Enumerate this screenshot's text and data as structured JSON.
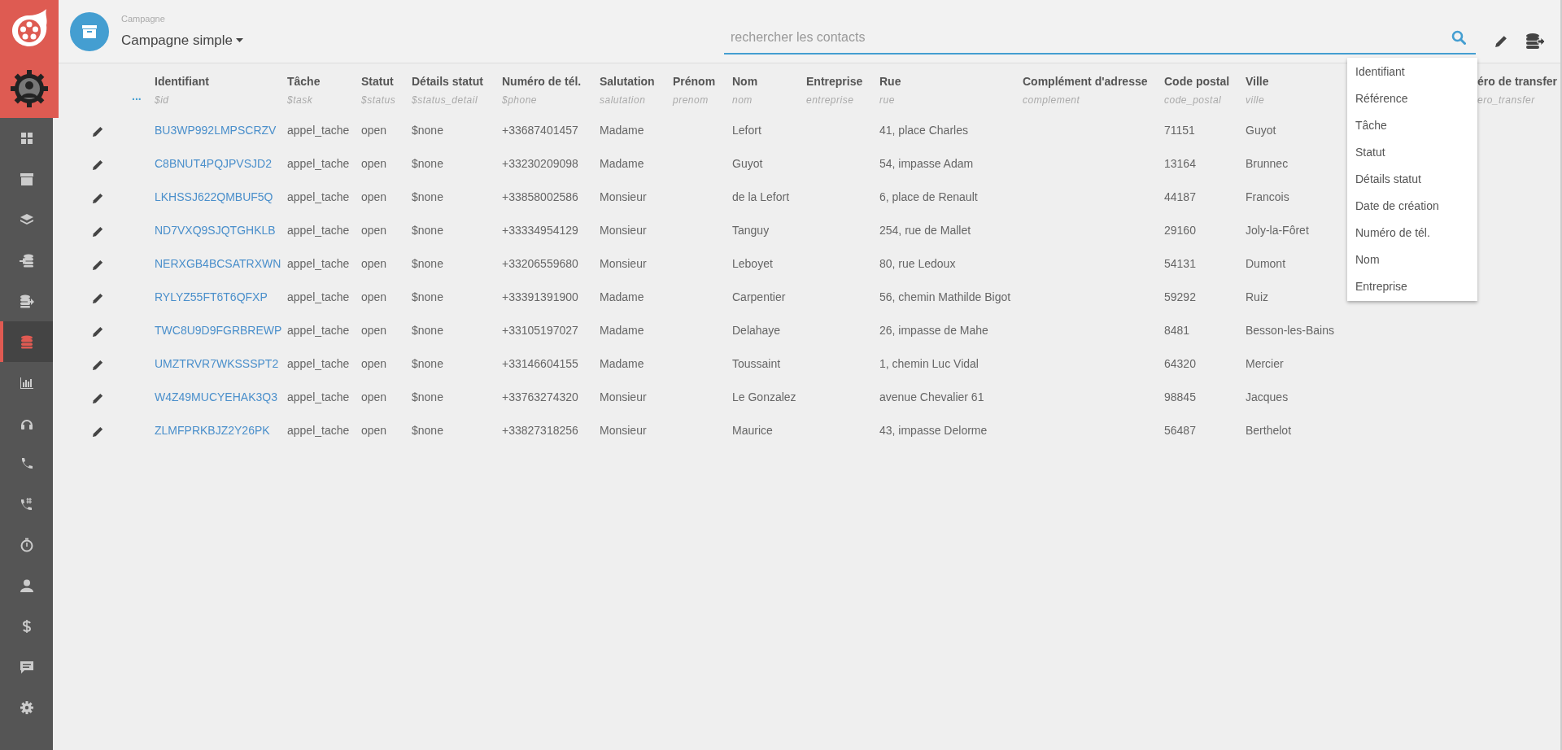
{
  "sidebar": {
    "items": [
      {
        "kind": "grid",
        "selected": false
      },
      {
        "kind": "archive",
        "selected": false
      },
      {
        "kind": "layers",
        "selected": false
      },
      {
        "kind": "db-import",
        "selected": false
      },
      {
        "kind": "db-export",
        "selected": false
      },
      {
        "kind": "database",
        "selected": true
      },
      {
        "kind": "chart",
        "selected": false
      },
      {
        "kind": "headset",
        "selected": false
      },
      {
        "kind": "phone",
        "selected": false
      },
      {
        "kind": "phone-hash",
        "selected": false
      },
      {
        "kind": "stopwatch",
        "selected": false
      },
      {
        "kind": "user",
        "selected": false
      },
      {
        "kind": "dollar",
        "selected": false
      },
      {
        "kind": "chat",
        "selected": false
      },
      {
        "kind": "gear",
        "selected": false
      }
    ]
  },
  "header": {
    "campaign_label": "Campagne",
    "campaign_name": "Campagne simple",
    "search": {
      "placeholder": "rechercher les contacts"
    }
  },
  "table": {
    "more_button": "...",
    "columns": [
      {
        "label": "Identifiant",
        "sub": "$id"
      },
      {
        "label": "Tâche",
        "sub": "$task"
      },
      {
        "label": "Statut",
        "sub": "$status"
      },
      {
        "label": "Détails statut",
        "sub": "$status_detail"
      },
      {
        "label": "Numéro de tél.",
        "sub": "$phone"
      },
      {
        "label": "Salutation",
        "sub": "salutation"
      },
      {
        "label": "Prénom",
        "sub": "prenom"
      },
      {
        "label": "Nom",
        "sub": "nom"
      },
      {
        "label": "Entreprise",
        "sub": "entreprise"
      },
      {
        "label": "Rue",
        "sub": "rue"
      },
      {
        "label": "Complément d'adresse",
        "sub": "complement"
      },
      {
        "label": "Code postal",
        "sub": "code_postal"
      },
      {
        "label": "Ville",
        "sub": "ville"
      },
      {
        "label": "éro de transfer",
        "sub": "ero_transfer"
      }
    ],
    "rows": [
      {
        "id": "BU3WP992LMPSCRZV",
        "task": "appel_tache",
        "status": "open",
        "status_detail": "$none",
        "phone": "+33687401457",
        "salutation": "Madame",
        "nom": "Lefort",
        "rue": "41, place Charles",
        "code_postal": "71151",
        "ville": "Guyot"
      },
      {
        "id": "C8BNUT4PQJPVSJD2",
        "task": "appel_tache",
        "status": "open",
        "status_detail": "$none",
        "phone": "+33230209098",
        "salutation": "Madame",
        "nom": "Guyot",
        "rue": "54, impasse Adam",
        "code_postal": "13164",
        "ville": "Brunnec"
      },
      {
        "id": "LKHSSJ622QMBUF5Q",
        "task": "appel_tache",
        "status": "open",
        "status_detail": "$none",
        "phone": "+33858002586",
        "salutation": "Monsieur",
        "nom": "de la Lefort",
        "rue": "6, place de Renault",
        "code_postal": "44187",
        "ville": "Francois"
      },
      {
        "id": "ND7VXQ9SJQTGHKLB",
        "task": "appel_tache",
        "status": "open",
        "status_detail": "$none",
        "phone": "+33334954129",
        "salutation": "Monsieur",
        "nom": "Tanguy",
        "rue": "254, rue de Mallet",
        "code_postal": "29160",
        "ville": "Joly-la-Fôret"
      },
      {
        "id": "NERXGB4BCSATRXWN",
        "task": "appel_tache",
        "status": "open",
        "status_detail": "$none",
        "phone": "+33206559680",
        "salutation": "Monsieur",
        "nom": "Leboyet",
        "rue": "80, rue Ledoux",
        "code_postal": "54131",
        "ville": "Dumont"
      },
      {
        "id": "RYLYZ55FT6T6QFXP",
        "task": "appel_tache",
        "status": "open",
        "status_detail": "$none",
        "phone": "+33391391900",
        "salutation": "Madame",
        "nom": "Carpentier",
        "rue": "56, chemin Mathilde Bigot",
        "code_postal": "59292",
        "ville": "Ruiz"
      },
      {
        "id": "TWC8U9D9FGRBREWP",
        "task": "appel_tache",
        "status": "open",
        "status_detail": "$none",
        "phone": "+33105197027",
        "salutation": "Madame",
        "nom": "Delahaye",
        "rue": "26, impasse de Mahe",
        "code_postal": "8481",
        "ville": "Besson-les-Bains"
      },
      {
        "id": "UMZTRVR7WKSSSPT2",
        "task": "appel_tache",
        "status": "open",
        "status_detail": "$none",
        "phone": "+33146604155",
        "salutation": "Madame",
        "nom": "Toussaint",
        "rue": "1, chemin Luc Vidal",
        "code_postal": "64320",
        "ville": "Mercier"
      },
      {
        "id": "W4Z49MUCYEHAK3Q3",
        "task": "appel_tache",
        "status": "open",
        "status_detail": "$none",
        "phone": "+33763274320",
        "salutation": "Monsieur",
        "nom": "Le Gonzalez",
        "rue": "avenue Chevalier 61",
        "code_postal": "98845",
        "ville": "Jacques"
      },
      {
        "id": "ZLMFPRKBJZ2Y26PK",
        "task": "appel_tache",
        "status": "open",
        "status_detail": "$none",
        "phone": "+33827318256",
        "salutation": "Monsieur",
        "nom": "Maurice",
        "rue": "43, impasse Delorme",
        "code_postal": "56487",
        "ville": "Berthelot"
      }
    ]
  },
  "column_menu": {
    "items": [
      "Identifiant",
      "Référence",
      "Tâche",
      "Statut",
      "Détails statut",
      "Date de création",
      "Numéro de tél.",
      "Nom",
      "Entreprise"
    ]
  }
}
